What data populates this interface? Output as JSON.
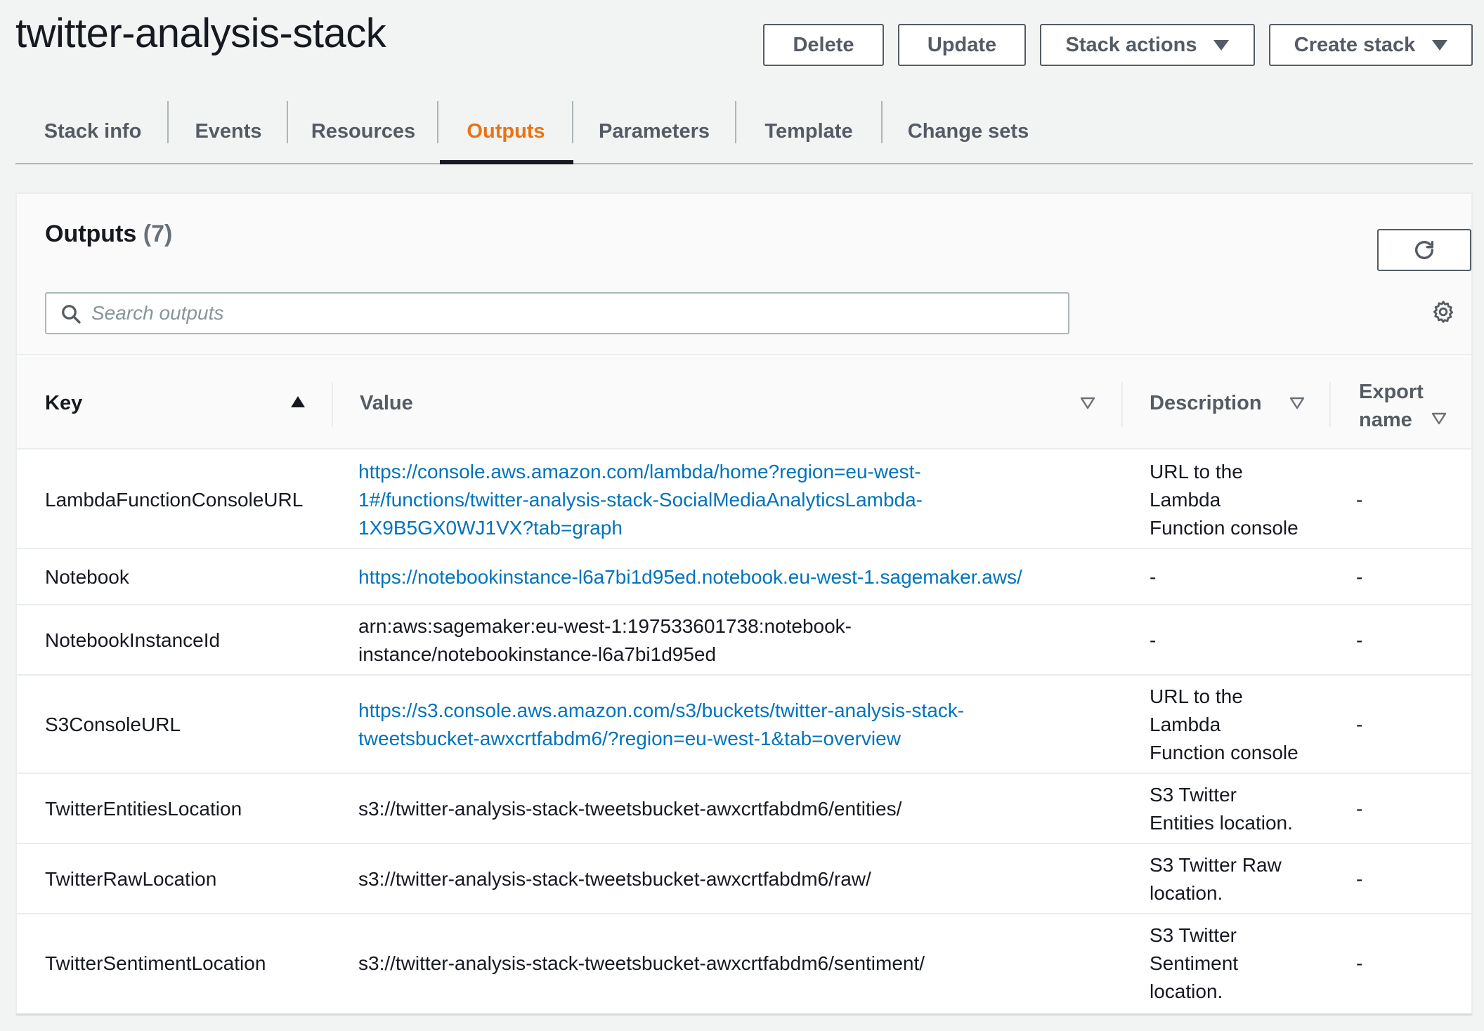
{
  "page_title": "twitter-analysis-stack",
  "header_buttons": {
    "delete": "Delete",
    "update": "Update",
    "stack_actions": "Stack actions",
    "create_stack": "Create stack"
  },
  "tabs": [
    {
      "label": "Stack info"
    },
    {
      "label": "Events"
    },
    {
      "label": "Resources"
    },
    {
      "label": "Outputs",
      "active": true
    },
    {
      "label": "Parameters"
    },
    {
      "label": "Template"
    },
    {
      "label": "Change sets"
    }
  ],
  "outputs": {
    "title": "Outputs",
    "count": "(7)",
    "search_placeholder": "Search outputs",
    "columns": {
      "key": "Key",
      "value": "Value",
      "description": "Description",
      "export_name_line1": "Export",
      "export_name_line2": "name"
    },
    "rows": [
      {
        "key": "LambdaFunctionConsoleURL",
        "value_lines": [
          "https://console.aws.amazon.com/lambda/home?region=eu-west-",
          "1#/functions/twitter-analysis-stack-SocialMediaAnalyticsLambda-",
          "1X9B5GX0WJ1VX?tab=graph"
        ],
        "is_link": true,
        "desc_lines": [
          "URL to the",
          "Lambda",
          "Function console"
        ],
        "export": "-"
      },
      {
        "key": "Notebook",
        "value_lines": [
          "https://notebookinstance-l6a7bi1d95ed.notebook.eu-west-1.sagemaker.aws/"
        ],
        "is_link": true,
        "desc_lines": [
          "-"
        ],
        "export": "-"
      },
      {
        "key": "NotebookInstanceId",
        "value_lines": [
          "arn:aws:sagemaker:eu-west-1:197533601738:notebook-",
          "instance/notebookinstance-l6a7bi1d95ed"
        ],
        "is_link": false,
        "desc_lines": [
          "-"
        ],
        "export": "-"
      },
      {
        "key": "S3ConsoleURL",
        "value_lines": [
          "https://s3.console.aws.amazon.com/s3/buckets/twitter-analysis-stack-",
          "tweetsbucket-awxcrtfabdm6/?region=eu-west-1&tab=overview"
        ],
        "is_link": true,
        "desc_lines": [
          "URL to the",
          "Lambda",
          "Function console"
        ],
        "export": "-"
      },
      {
        "key": "TwitterEntitiesLocation",
        "value_lines": [
          "s3://twitter-analysis-stack-tweetsbucket-awxcrtfabdm6/entities/"
        ],
        "is_link": false,
        "desc_lines": [
          "S3 Twitter",
          "Entities location."
        ],
        "export": "-"
      },
      {
        "key": "TwitterRawLocation",
        "value_lines": [
          "s3://twitter-analysis-stack-tweetsbucket-awxcrtfabdm6/raw/"
        ],
        "is_link": false,
        "desc_lines": [
          "S3 Twitter Raw",
          "location."
        ],
        "export": "-"
      },
      {
        "key": "TwitterSentimentLocation",
        "value_lines": [
          "s3://twitter-analysis-stack-tweetsbucket-awxcrtfabdm6/sentiment/"
        ],
        "is_link": false,
        "desc_lines": [
          "S3 Twitter",
          "Sentiment",
          "location."
        ],
        "export": "-"
      }
    ]
  },
  "colors": {
    "accent_tab": "#ec7211",
    "link": "#0073bb",
    "text": "#16191f",
    "muted": "#545b64"
  },
  "icons": {
    "refresh": "refresh-icon",
    "search": "search-icon",
    "settings": "gear-icon",
    "sort_asc": "sort-ascending-icon",
    "sort_none": "sort-descending-outline-icon",
    "dropdown": "caret-down-icon"
  }
}
